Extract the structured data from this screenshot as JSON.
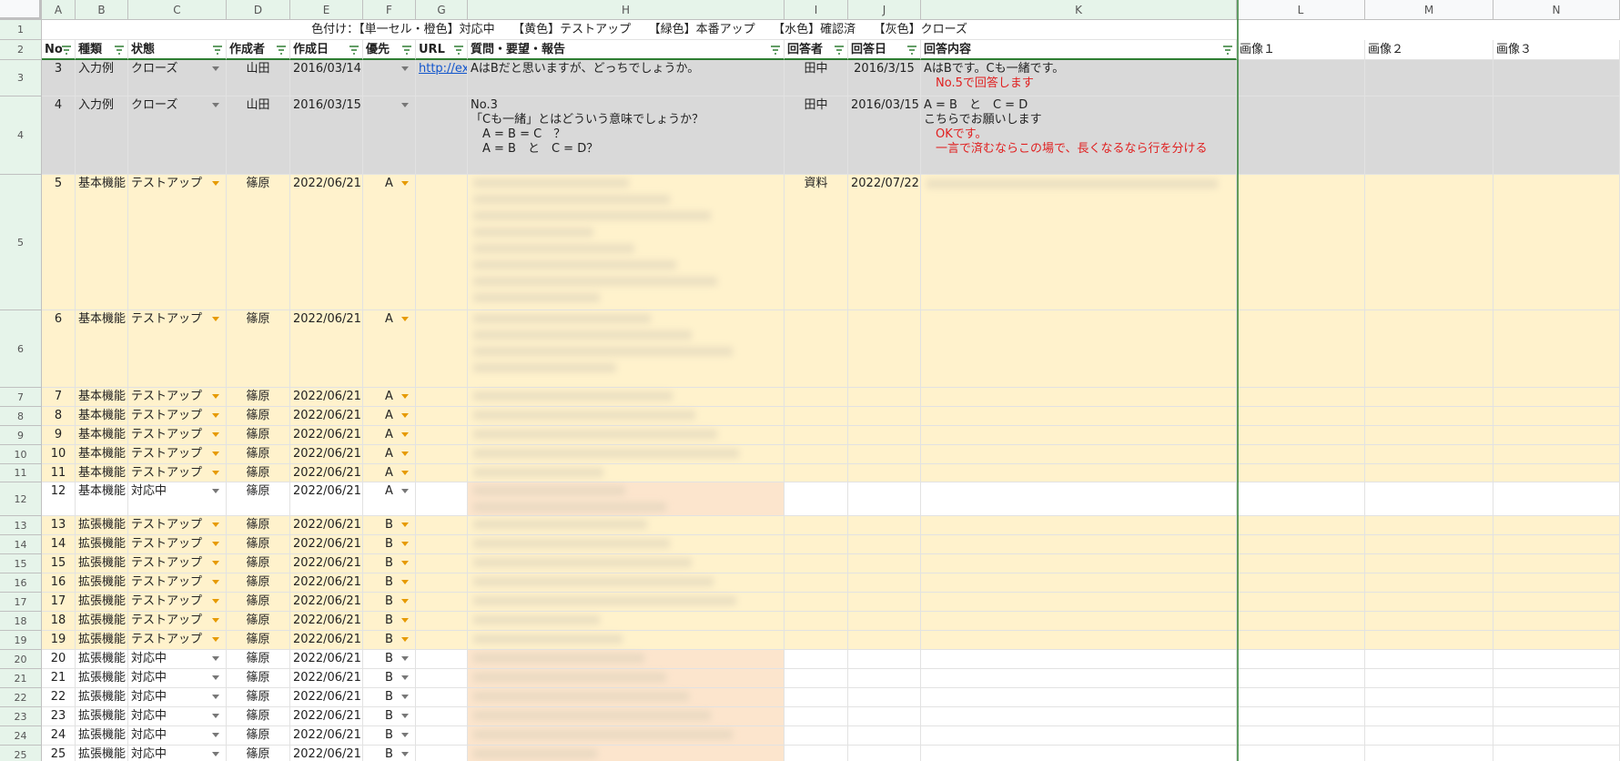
{
  "legend": "色付け：【単一セル・橙色】対応中　　【黄色】テストアップ　　【緑色】本番アップ　　【水色】確認済　　【灰色】クローズ",
  "columns": [
    "A",
    "B",
    "C",
    "D",
    "E",
    "F",
    "G",
    "H",
    "I",
    "J",
    "K",
    "L",
    "M",
    "N"
  ],
  "headers": {
    "no": "No",
    "type": "種類",
    "status": "状態",
    "author": "作成者",
    "created": "作成日",
    "priority": "優先",
    "url": "URL",
    "question": "質問・要望・報告",
    "responder": "回答者",
    "answer_date": "回答日",
    "answer": "回答内容",
    "image1": "画像１",
    "image2": "画像２",
    "image3": "画像３"
  },
  "rows": [
    {
      "row_num": "3",
      "no": "3",
      "type": "入力例",
      "status": "クローズ",
      "author": "山田",
      "created": "2016/03/14",
      "priority": "",
      "url": "http://exa",
      "question": "AはBだと思いますが、どっちでしょうか。",
      "responder": "田中",
      "answer_date": "2016/3/15",
      "answer": "AはBです。Cも一緒です。",
      "answer_red": "　No.5で回答します",
      "fill": "#d9d9d9"
    },
    {
      "row_num": "4",
      "no": "4",
      "type": "入力例",
      "status": "クローズ",
      "author": "山田",
      "created": "2016/03/15",
      "priority": "",
      "url": "",
      "question": "No.3\n「Cも一緒」とはどういう意味でしょうか？\n　A = B = C　？\n　A = B　と　C = D？",
      "responder": "田中",
      "answer_date": "2016/03/15",
      "answer": "A = B　と　C = D\nこちらでお願いします",
      "answer_red": "　OKです。\n　一言で済むならこの場で、長くなるなら行を分ける",
      "fill": "#d9d9d9"
    },
    {
      "row_num": "5",
      "no": "5",
      "type": "基本機能",
      "status": "テストアップ",
      "author": "篠原",
      "created": "2022/06/21",
      "priority": "A",
      "url": "",
      "question": "",
      "responder": "資料",
      "answer_date": "2022/07/22",
      "answer": "",
      "answer_red": "",
      "fill": "#fff2cc"
    },
    {
      "row_num": "6",
      "no": "6",
      "type": "基本機能",
      "status": "テストアップ",
      "author": "篠原",
      "created": "2022/06/21",
      "priority": "A",
      "url": "",
      "question": "",
      "responder": "",
      "answer_date": "",
      "answer": "",
      "answer_red": "",
      "fill": "#fff2cc"
    },
    {
      "row_num": "7",
      "no": "7",
      "type": "基本機能",
      "status": "テストアップ",
      "author": "篠原",
      "created": "2022/06/21",
      "priority": "A",
      "url": "",
      "question": "",
      "responder": "",
      "answer_date": "",
      "answer": "",
      "answer_red": "",
      "fill": "#fff2cc"
    },
    {
      "row_num": "8",
      "no": "8",
      "type": "基本機能",
      "status": "テストアップ",
      "author": "篠原",
      "created": "2022/06/21",
      "priority": "A",
      "url": "",
      "question": "",
      "responder": "",
      "answer_date": "",
      "answer": "",
      "answer_red": "",
      "fill": "#fff2cc"
    },
    {
      "row_num": "9",
      "no": "9",
      "type": "基本機能",
      "status": "テストアップ",
      "author": "篠原",
      "created": "2022/06/21",
      "priority": "A",
      "url": "",
      "question": "",
      "responder": "",
      "answer_date": "",
      "answer": "",
      "answer_red": "",
      "fill": "#fff2cc"
    },
    {
      "row_num": "10",
      "no": "10",
      "type": "基本機能",
      "status": "テストアップ",
      "author": "篠原",
      "created": "2022/06/21",
      "priority": "A",
      "url": "",
      "question": "",
      "responder": "",
      "answer_date": "",
      "answer": "",
      "answer_red": "",
      "fill": "#fff2cc"
    },
    {
      "row_num": "11",
      "no": "11",
      "type": "基本機能",
      "status": "テストアップ",
      "author": "篠原",
      "created": "2022/06/21",
      "priority": "A",
      "url": "",
      "question": "",
      "responder": "",
      "answer_date": "",
      "answer": "",
      "answer_red": "",
      "fill": "#fff2cc"
    },
    {
      "row_num": "12",
      "no": "12",
      "type": "基本機能",
      "status": "対応中",
      "author": "篠原",
      "created": "2022/06/21",
      "priority": "A",
      "url": "",
      "question": "",
      "responder": "",
      "answer_date": "",
      "answer": "",
      "answer_red": "",
      "fill": "#ffffff"
    },
    {
      "row_num": "13",
      "no": "13",
      "type": "拡張機能",
      "status": "テストアップ",
      "author": "篠原",
      "created": "2022/06/21",
      "priority": "B",
      "url": "",
      "question": "",
      "responder": "",
      "answer_date": "",
      "answer": "",
      "answer_red": "",
      "fill": "#fff2cc"
    },
    {
      "row_num": "14",
      "no": "14",
      "type": "拡張機能",
      "status": "テストアップ",
      "author": "篠原",
      "created": "2022/06/21",
      "priority": "B",
      "url": "",
      "question": "",
      "responder": "",
      "answer_date": "",
      "answer": "",
      "answer_red": "",
      "fill": "#fff2cc"
    },
    {
      "row_num": "15",
      "no": "15",
      "type": "拡張機能",
      "status": "テストアップ",
      "author": "篠原",
      "created": "2022/06/21",
      "priority": "B",
      "url": "",
      "question": "",
      "responder": "",
      "answer_date": "",
      "answer": "",
      "answer_red": "",
      "fill": "#fff2cc"
    },
    {
      "row_num": "16",
      "no": "16",
      "type": "拡張機能",
      "status": "テストアップ",
      "author": "篠原",
      "created": "2022/06/21",
      "priority": "B",
      "url": "",
      "question": "",
      "responder": "",
      "answer_date": "",
      "answer": "",
      "answer_red": "",
      "fill": "#fff2cc"
    },
    {
      "row_num": "17",
      "no": "17",
      "type": "拡張機能",
      "status": "テストアップ",
      "author": "篠原",
      "created": "2022/06/21",
      "priority": "B",
      "url": "",
      "question": "",
      "responder": "",
      "answer_date": "",
      "answer": "",
      "answer_red": "",
      "fill": "#fff2cc"
    },
    {
      "row_num": "18",
      "no": "18",
      "type": "拡張機能",
      "status": "テストアップ",
      "author": "篠原",
      "created": "2022/06/21",
      "priority": "B",
      "url": "",
      "question": "",
      "responder": "",
      "answer_date": "",
      "answer": "",
      "answer_red": "",
      "fill": "#fff2cc"
    },
    {
      "row_num": "19",
      "no": "19",
      "type": "拡張機能",
      "status": "テストアップ",
      "author": "篠原",
      "created": "2022/06/21",
      "priority": "B",
      "url": "",
      "question": "",
      "responder": "",
      "answer_date": "",
      "answer": "",
      "answer_red": "",
      "fill": "#fff2cc"
    },
    {
      "row_num": "20",
      "no": "20",
      "type": "拡張機能",
      "status": "対応中",
      "author": "篠原",
      "created": "2022/06/21",
      "priority": "B",
      "url": "",
      "question": "",
      "responder": "",
      "answer_date": "",
      "answer": "",
      "answer_red": "",
      "fill": "#ffffff"
    },
    {
      "row_num": "21",
      "no": "21",
      "type": "拡張機能",
      "status": "対応中",
      "author": "篠原",
      "created": "2022/06/21",
      "priority": "B",
      "url": "",
      "question": "",
      "responder": "",
      "answer_date": "",
      "answer": "",
      "answer_red": "",
      "fill": "#ffffff"
    },
    {
      "row_num": "22",
      "no": "22",
      "type": "拡張機能",
      "status": "対応中",
      "author": "篠原",
      "created": "2022/06/21",
      "priority": "B",
      "url": "",
      "question": "",
      "responder": "",
      "answer_date": "",
      "answer": "",
      "answer_red": "",
      "fill": "#ffffff"
    },
    {
      "row_num": "23",
      "no": "23",
      "type": "拡張機能",
      "status": "対応中",
      "author": "篠原",
      "created": "2022/06/21",
      "priority": "B",
      "url": "",
      "question": "",
      "responder": "",
      "answer_date": "",
      "answer": "",
      "answer_red": "",
      "fill": "#ffffff"
    },
    {
      "row_num": "24",
      "no": "24",
      "type": "拡張機能",
      "status": "対応中",
      "author": "篠原",
      "created": "2022/06/21",
      "priority": "B",
      "url": "",
      "question": "",
      "responder": "",
      "answer_date": "",
      "answer": "",
      "answer_red": "",
      "fill": "#ffffff"
    },
    {
      "row_num": "25",
      "no": "25",
      "type": "拡張機能",
      "status": "対応中",
      "author": "篠原",
      "created": "2022/06/21",
      "priority": "B",
      "url": "",
      "question": "",
      "responder": "",
      "answer_date": "",
      "answer": "",
      "answer_red": "",
      "fill": "#ffffff"
    }
  ],
  "colors": {
    "gray": "#d9d9d9",
    "yellow": "#fff2cc",
    "orange": "#fce5cd",
    "header_green": "#e6f4ea",
    "link": "#1155cc",
    "accent_red": "#e02020",
    "dropdown_orange": "#e69a00"
  }
}
